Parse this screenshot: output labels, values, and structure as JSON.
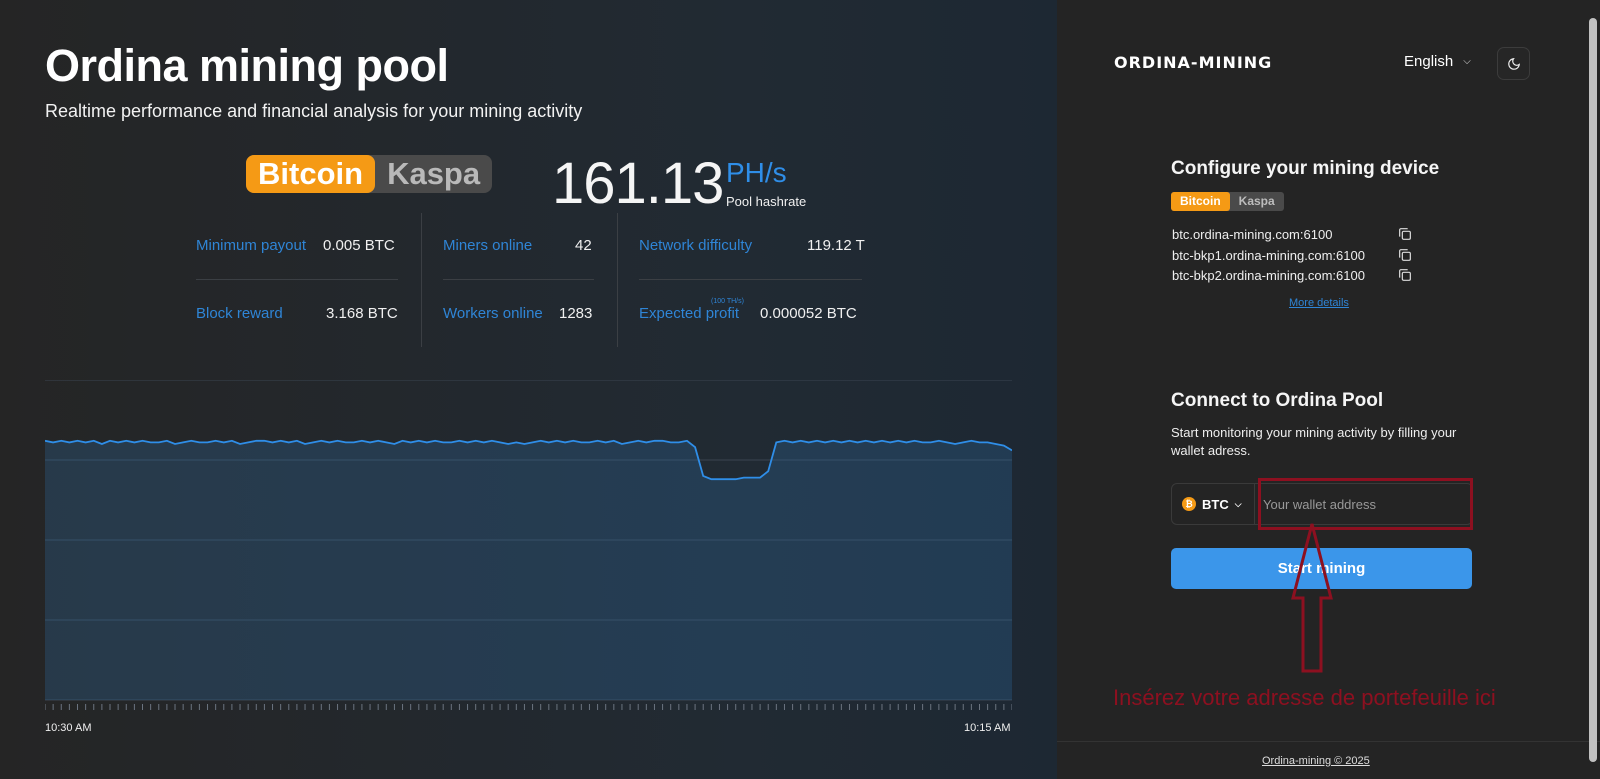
{
  "hero": {
    "title": "Ordina mining pool",
    "subtitle": "Realtime performance and financial analysis for your mining activity",
    "coins": [
      "Bitcoin",
      "Kaspa"
    ],
    "selected_coin": "Bitcoin",
    "hashrate_value": "161.13",
    "hashrate_unit": "PH/s",
    "hashrate_label": "Pool hashrate"
  },
  "stats": {
    "min_payout_label": "Minimum payout",
    "min_payout_value": "0.005 BTC",
    "block_reward_label": "Block reward",
    "block_reward_value": "3.168 BTC",
    "miners_online_label": "Miners online",
    "miners_online_value": "42",
    "workers_online_label": "Workers online",
    "workers_online_value": "1283",
    "network_difficulty_label": "Network difficulty",
    "network_difficulty_value": "119.12 T",
    "expected_profit_label": "Expected profit",
    "expected_profit_note": "(100 TH/s)",
    "expected_profit_value": "0.000052 BTC"
  },
  "chart_data": {
    "type": "area",
    "x_labels": [
      "10:30 AM",
      "10:15 AM"
    ],
    "ylim": [
      0,
      200
    ],
    "grid": true,
    "series": [
      {
        "values": [
          162,
          161,
          162,
          161,
          162,
          161,
          162,
          160,
          162,
          161,
          162,
          161,
          162,
          161,
          161,
          162,
          160,
          161,
          162,
          161,
          161,
          162,
          161,
          162,
          160,
          161,
          162,
          162,
          161,
          162,
          161,
          162,
          160,
          161,
          162,
          161,
          162,
          161,
          161,
          162,
          161,
          162,
          161,
          160,
          162,
          161,
          162,
          161,
          162,
          161,
          161,
          162,
          161,
          162,
          161,
          162,
          161,
          160,
          161,
          160,
          161,
          162,
          161,
          162,
          161,
          162,
          161,
          161,
          162,
          161,
          162,
          160,
          161,
          162,
          161,
          162,
          162,
          161,
          161,
          162,
          158,
          140,
          138,
          138,
          138,
          138,
          139,
          139,
          139,
          143,
          161,
          162,
          161,
          162,
          161,
          162,
          161,
          162,
          161,
          162,
          161,
          162,
          161,
          162,
          161,
          162,
          161,
          162,
          161,
          161,
          162,
          161,
          160,
          161,
          162,
          161,
          161,
          160,
          159,
          156
        ]
      }
    ],
    "color": "#2f8ee8"
  },
  "header": {
    "logo": "ORDINA-MINING",
    "language": "English"
  },
  "config": {
    "title": "Configure your mining device",
    "coins": [
      "Bitcoin",
      "Kaspa"
    ],
    "servers": [
      "btc.ordina-mining.com:6100",
      "btc-bkp1.ordina-mining.com:6100",
      "btc-bkp2.ordina-mining.com:6100"
    ],
    "more_details": "More details"
  },
  "connect": {
    "title": "Connect to Ordina Pool",
    "description": "Start monitoring your mining activity by filling your wallet adress.",
    "coin": "BTC",
    "wallet_placeholder": "Your wallet address",
    "wallet_value": "",
    "start_button": "Start mining"
  },
  "annotation": {
    "text": "Insérez votre adresse de portefeuille ici",
    "color": "#8d1020"
  },
  "footer": {
    "text": "Ordina-mining © 2025"
  }
}
